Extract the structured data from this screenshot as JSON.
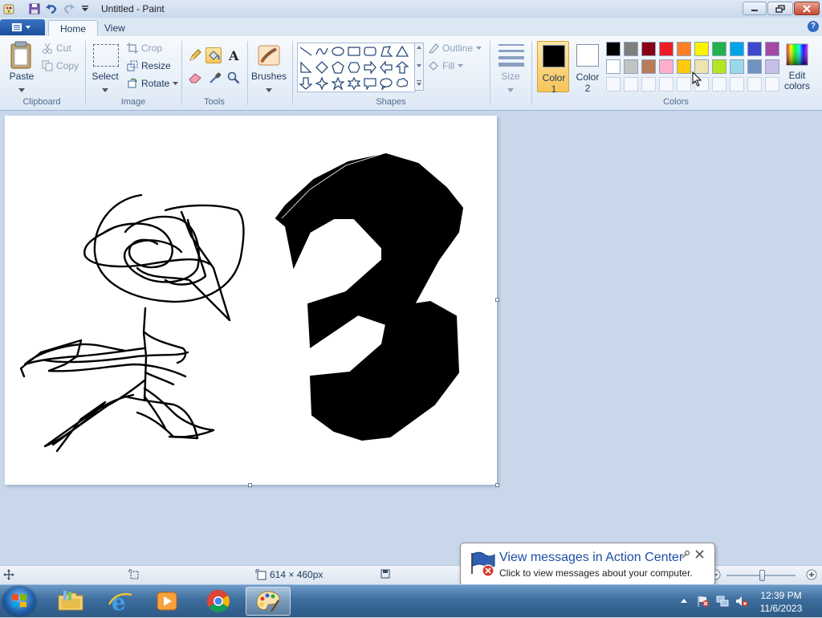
{
  "window": {
    "title": "Untitled - Paint",
    "quick_access": [
      "paint-app-icon",
      "save-icon",
      "undo-icon",
      "redo-icon",
      "customize-quick-access-icon"
    ]
  },
  "tabs": {
    "home": "Home",
    "view": "View"
  },
  "ribbon": {
    "clipboard": {
      "label": "Clipboard",
      "paste": "Paste",
      "cut": "Cut",
      "copy": "Copy"
    },
    "image": {
      "label": "Image",
      "select": "Select",
      "crop": "Crop",
      "resize": "Resize",
      "rotate": "Rotate"
    },
    "tools": {
      "label": "Tools"
    },
    "brushes": {
      "label": "Brushes"
    },
    "shapes": {
      "label": "Shapes",
      "outline": "Outline",
      "fill": "Fill"
    },
    "size": {
      "label": "Size"
    },
    "colors": {
      "label": "Colors",
      "color1": {
        "label_line1": "Color",
        "label_line2": "1",
        "value": "#000000"
      },
      "color2": {
        "label_line1": "Color",
        "label_line2": "2",
        "value": "#ffffff"
      },
      "edit_line1": "Edit",
      "edit_line2": "colors",
      "palette_row1": [
        "#000000",
        "#7f7f7f",
        "#880015",
        "#ed1c24",
        "#ff7f27",
        "#fff200",
        "#22b14c",
        "#00a2e8",
        "#3f48cc",
        "#a349a4"
      ],
      "palette_row2": [
        "#ffffff",
        "#c3c3c3",
        "#b97a57",
        "#ffaec9",
        "#ffc90e",
        "#efe4b0",
        "#b5e61d",
        "#99d9ea",
        "#7092be",
        "#c8bfe7"
      ]
    }
  },
  "status": {
    "canvas_size": "614 × 460px"
  },
  "notification": {
    "title": "View messages in Action Center",
    "body": "Click to view messages about your computer."
  },
  "taskbar": {
    "time": "12:39 PM",
    "date": "11/6/2023",
    "apps": [
      "windows-explorer",
      "internet-explorer",
      "media-player",
      "chrome",
      "paint"
    ]
  }
}
